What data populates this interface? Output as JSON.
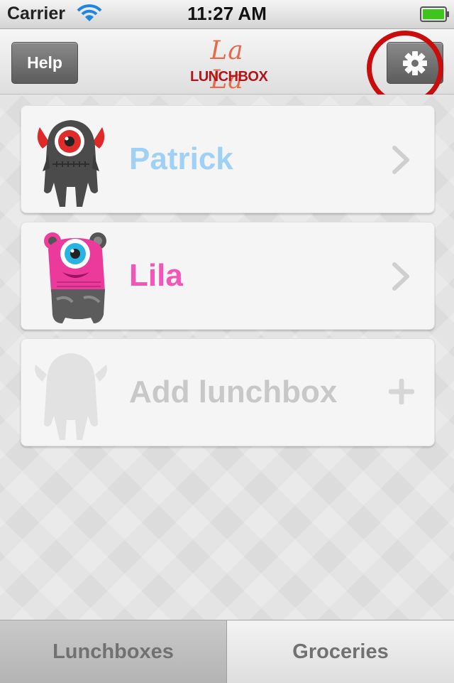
{
  "status_bar": {
    "carrier": "Carrier",
    "time": "11:27 AM",
    "battery_color": "#3fc31d"
  },
  "nav_bar": {
    "help_label": "Help",
    "logo_top": "La La",
    "logo_bottom": "LUNCHBOX",
    "settings_icon": "gear-icon"
  },
  "annotation": {
    "label": "settings",
    "color": "#c90d0d"
  },
  "lunchboxes": [
    {
      "name": "Patrick",
      "color": "#9fd0f5",
      "avatar": "gray-one-eyed-horned-monster",
      "accessory": "chevron-right-icon"
    },
    {
      "name": "Lila",
      "color": "#f257b8",
      "avatar": "pink-one-eyed-monster",
      "accessory": "chevron-right-icon"
    },
    {
      "name": "Add lunchbox",
      "color": "#c8c8c8",
      "avatar": "monster-silhouette-placeholder",
      "accessory": "plus-icon"
    }
  ],
  "tabs": [
    {
      "label": "Lunchboxes",
      "selected": true
    },
    {
      "label": "Groceries",
      "selected": false
    }
  ]
}
